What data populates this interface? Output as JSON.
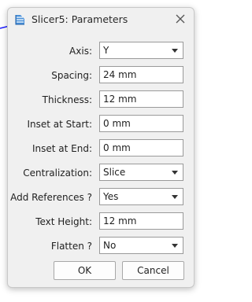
{
  "window": {
    "title": "Slicer5: Parameters"
  },
  "fields": [
    {
      "label": "Axis:",
      "value": "Y",
      "type": "dropdown"
    },
    {
      "label": "Spacing:",
      "value": "24 mm",
      "type": "text"
    },
    {
      "label": "Thickness:",
      "value": "12 mm",
      "type": "text"
    },
    {
      "label": "Inset at Start:",
      "value": "0 mm",
      "type": "text"
    },
    {
      "label": "Inset at End:",
      "value": "0 mm",
      "type": "text"
    },
    {
      "label": "Centralization:",
      "value": "Slice",
      "type": "dropdown"
    },
    {
      "label": "Add References ?",
      "value": "Yes",
      "type": "dropdown"
    },
    {
      "label": "Text Height:",
      "value": "12 mm",
      "type": "text"
    },
    {
      "label": "Flatten ?",
      "value": "No",
      "type": "dropdown"
    }
  ],
  "buttons": {
    "ok": "OK",
    "cancel": "Cancel"
  },
  "icons": {
    "title": "slicer-icon",
    "close": "close-icon",
    "dropdown": "chevron-down-icon"
  },
  "colors": {
    "accent": "#1f6fc8",
    "background_line": "#1a1aff"
  }
}
